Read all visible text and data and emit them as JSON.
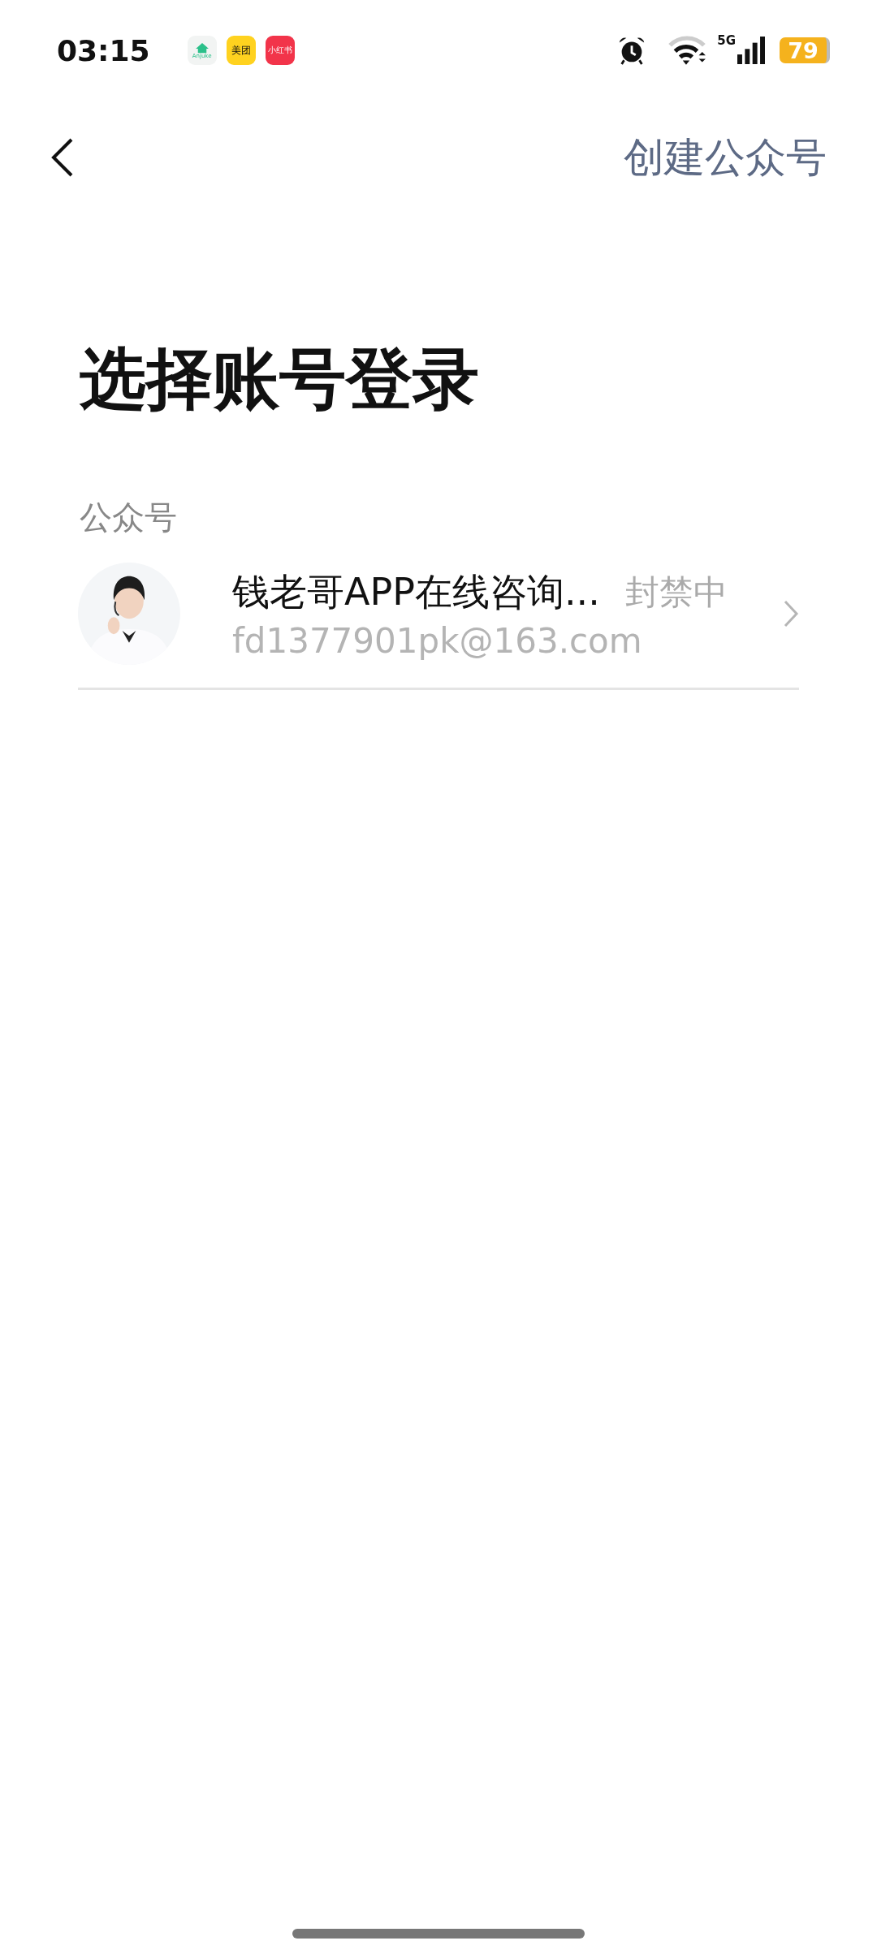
{
  "status_bar": {
    "time": "03:15",
    "app_icons": [
      {
        "label": "Anjuke",
        "kind": "house",
        "color": "#f2f4f3"
      },
      {
        "label": "美团",
        "kind": "plain",
        "color": "#ffd21f"
      },
      {
        "label": "小红书",
        "kind": "plain",
        "color": "#f2344a"
      }
    ],
    "network": "5G",
    "battery": "79"
  },
  "nav": {
    "action": "创建公众号"
  },
  "title": "选择账号登录",
  "section": {
    "label": "公众号",
    "accounts": [
      {
        "name": "钱老哥APP在线咨询...",
        "email": "fd1377901pk@163.com",
        "status": "封禁中"
      }
    ]
  }
}
